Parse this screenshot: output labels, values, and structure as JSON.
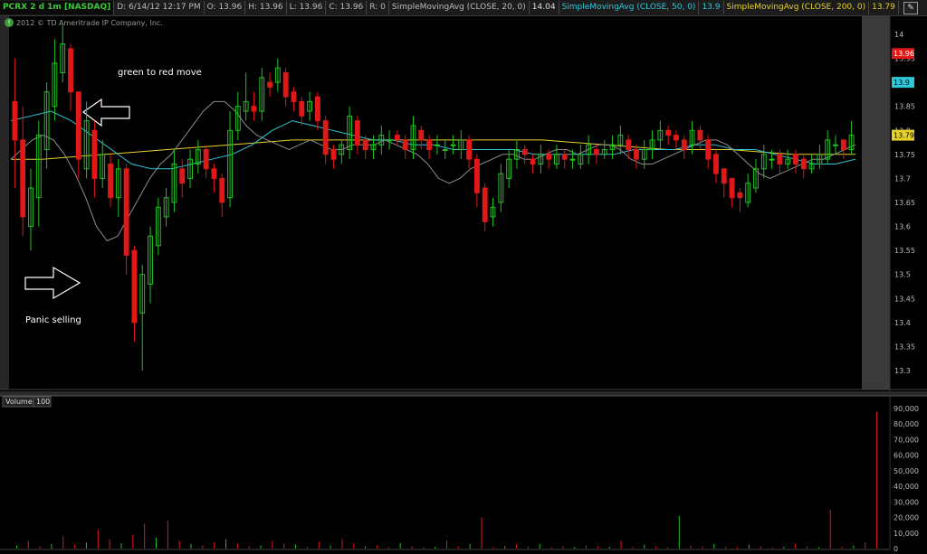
{
  "header": {
    "symbol": "PCRX 2 d 1m [NASDAQ]",
    "date": "D: 6/14/12 12:17 PM",
    "open": "O: 13.96",
    "high": "H: 13.96",
    "low": "L: 13.96",
    "close": "C: 13.96",
    "range": "R: 0",
    "sma20_label": "SimpleMovingAvg (CLOSE, 20, 0)",
    "sma20_value": "14.04",
    "sma50_label": "SimpleMovingAvg (CLOSE, 50, 0)",
    "sma50_value": "13.9",
    "sma200_label": "SimpleMovingAvg (CLOSE, 200, 0)",
    "sma200_value": "13.79",
    "tool_icon": "drawing-tools-icon"
  },
  "copyright": "2012 © TD Ameritrade IP Company, Inc.",
  "annotations": {
    "top": "green to red move",
    "bottom": "Panic selling"
  },
  "volume_panel": {
    "label": "Volume",
    "period": "100"
  },
  "colors": {
    "up": "#22c022",
    "down": "#e01818",
    "sma20": "#8c8c8c",
    "sma50": "#2ec8d8",
    "sma200": "#e6d22a",
    "price_badge": "#e01818",
    "sma50_badge": "#2ec8d8",
    "sma200_badge": "#e6d22a"
  },
  "chart_data": [
    {
      "type": "candlestick",
      "title": "PCRX 2 d 1m [NASDAQ]",
      "ylim": [
        13.27,
        14.03
      ],
      "y_ticks": [
        "14",
        "13.95",
        "13.9",
        "13.85",
        "13.8",
        "13.75",
        "13.7",
        "13.65",
        "13.6",
        "13.55",
        "13.5",
        "13.45",
        "13.4",
        "13.35",
        "13.3"
      ],
      "badges": [
        {
          "name": "price",
          "value": 13.96,
          "text": "13.96"
        },
        {
          "name": "sma50",
          "value": 13.9,
          "text": "13.9"
        },
        {
          "name": "sma200",
          "value": 13.79,
          "text": "13.79"
        }
      ],
      "candles_open": [
        13.86,
        13.78,
        13.6,
        13.66,
        13.76,
        13.85,
        13.92,
        13.97,
        13.88,
        13.72,
        13.8,
        13.7,
        13.73,
        13.66,
        13.72,
        13.55,
        13.42,
        13.48,
        13.56,
        13.62,
        13.65,
        13.72,
        13.7,
        13.73,
        13.76,
        13.72,
        13.7,
        13.66,
        13.8,
        13.84,
        13.85,
        13.84,
        13.9,
        13.9,
        13.92,
        13.88,
        13.86,
        13.84,
        13.87,
        13.82,
        13.76,
        13.75,
        13.76,
        13.82,
        13.78,
        13.76,
        13.77,
        13.78,
        13.79,
        13.78,
        13.76,
        13.8,
        13.78,
        13.77,
        13.76,
        13.77,
        13.76,
        13.78,
        13.74,
        13.68,
        13.62,
        13.65,
        13.7,
        13.74,
        13.76,
        13.74,
        13.73,
        13.75,
        13.73,
        13.75,
        13.74,
        13.73,
        13.75,
        13.76,
        13.75,
        13.76,
        13.77,
        13.78,
        13.76,
        13.74,
        13.76,
        13.78,
        13.8,
        13.79,
        13.78,
        13.77,
        13.8,
        13.78,
        13.75,
        13.72,
        13.7,
        13.67,
        13.65,
        13.68,
        13.72,
        13.74,
        13.75,
        13.73,
        13.75,
        13.74,
        13.72,
        13.73,
        13.74,
        13.77,
        13.78,
        13.76
      ],
      "candles_close": [
        13.78,
        13.62,
        13.68,
        13.79,
        13.88,
        13.94,
        13.98,
        13.88,
        13.74,
        13.82,
        13.7,
        13.75,
        13.66,
        13.72,
        13.54,
        13.4,
        13.5,
        13.58,
        13.64,
        13.66,
        13.73,
        13.69,
        13.74,
        13.76,
        13.72,
        13.7,
        13.65,
        13.8,
        13.85,
        13.86,
        13.84,
        13.91,
        13.89,
        13.93,
        13.87,
        13.86,
        13.83,
        13.86,
        13.82,
        13.75,
        13.74,
        13.77,
        13.83,
        13.77,
        13.76,
        13.77,
        13.79,
        13.78,
        13.78,
        13.76,
        13.81,
        13.78,
        13.76,
        13.77,
        13.76,
        13.77,
        13.78,
        13.74,
        13.67,
        13.61,
        13.64,
        13.71,
        13.74,
        13.76,
        13.75,
        13.73,
        13.75,
        13.74,
        13.75,
        13.74,
        13.74,
        13.75,
        13.77,
        13.75,
        13.76,
        13.77,
        13.79,
        13.76,
        13.74,
        13.76,
        13.78,
        13.8,
        13.79,
        13.78,
        13.76,
        13.8,
        13.78,
        13.74,
        13.71,
        13.69,
        13.66,
        13.66,
        13.69,
        13.72,
        13.75,
        13.74,
        13.73,
        13.74,
        13.73,
        13.72,
        13.73,
        13.75,
        13.78,
        13.77,
        13.76,
        13.79
      ],
      "candles_high": [
        13.95,
        13.85,
        13.72,
        13.82,
        13.9,
        13.99,
        14.02,
        13.98,
        13.88,
        13.86,
        13.82,
        13.78,
        13.75,
        13.74,
        13.73,
        13.56,
        13.52,
        13.6,
        13.66,
        13.68,
        13.76,
        13.74,
        13.76,
        13.78,
        13.77,
        13.73,
        13.71,
        13.84,
        13.88,
        13.92,
        13.88,
        13.93,
        13.92,
        13.95,
        13.93,
        13.89,
        13.87,
        13.88,
        13.88,
        13.83,
        13.77,
        13.78,
        13.85,
        13.83,
        13.79,
        13.79,
        13.81,
        13.8,
        13.8,
        13.79,
        13.83,
        13.81,
        13.79,
        13.79,
        13.78,
        13.79,
        13.8,
        13.79,
        13.75,
        13.69,
        13.66,
        13.73,
        13.76,
        13.78,
        13.77,
        13.75,
        13.77,
        13.76,
        13.77,
        13.76,
        13.76,
        13.77,
        13.79,
        13.77,
        13.78,
        13.79,
        13.81,
        13.79,
        13.77,
        13.78,
        13.8,
        13.82,
        13.81,
        13.8,
        13.79,
        13.82,
        13.81,
        13.79,
        13.76,
        13.72,
        13.7,
        13.68,
        13.71,
        13.74,
        13.77,
        13.76,
        13.76,
        13.76,
        13.76,
        13.75,
        13.75,
        13.77,
        13.8,
        13.79,
        13.78,
        13.82
      ],
      "candles_low": [
        13.68,
        13.58,
        13.55,
        13.6,
        13.72,
        13.82,
        13.9,
        13.84,
        13.7,
        13.7,
        13.66,
        13.68,
        13.64,
        13.62,
        13.5,
        13.36,
        13.3,
        13.44,
        13.54,
        13.6,
        13.63,
        13.66,
        13.68,
        13.71,
        13.7,
        13.67,
        13.62,
        13.64,
        13.78,
        13.82,
        13.82,
        13.82,
        13.87,
        13.88,
        13.85,
        13.84,
        13.81,
        13.82,
        13.8,
        13.73,
        13.72,
        13.73,
        13.74,
        13.75,
        13.74,
        13.74,
        13.75,
        13.76,
        13.77,
        13.74,
        13.74,
        13.76,
        13.74,
        13.75,
        13.74,
        13.75,
        13.74,
        13.72,
        13.64,
        13.59,
        13.6,
        13.63,
        13.68,
        13.72,
        13.73,
        13.71,
        13.71,
        13.72,
        13.72,
        13.72,
        13.72,
        13.72,
        13.73,
        13.73,
        13.74,
        13.74,
        13.75,
        13.74,
        13.72,
        13.72,
        13.74,
        13.76,
        13.77,
        13.76,
        13.74,
        13.75,
        13.76,
        13.72,
        13.69,
        13.66,
        13.64,
        13.63,
        13.64,
        13.67,
        13.7,
        13.72,
        13.71,
        13.72,
        13.71,
        13.7,
        13.71,
        13.72,
        13.73,
        13.75,
        13.74,
        13.75
      ],
      "sma20": [
        13.74,
        13.76,
        13.78,
        13.79,
        13.78,
        13.75,
        13.71,
        13.66,
        13.6,
        13.57,
        13.58,
        13.62,
        13.66,
        13.7,
        13.73,
        13.75,
        13.78,
        13.81,
        13.84,
        13.86,
        13.86,
        13.84,
        13.81,
        13.79,
        13.78,
        13.77,
        13.76,
        13.77,
        13.78,
        13.77,
        13.76,
        13.76,
        13.77,
        13.77,
        13.77,
        13.78,
        13.77,
        13.76,
        13.75,
        13.73,
        13.7,
        13.69,
        13.7,
        13.72,
        13.73,
        13.74,
        13.75,
        13.75,
        13.74,
        13.74,
        13.75,
        13.76,
        13.76,
        13.75,
        13.76,
        13.77,
        13.77,
        13.76,
        13.74,
        13.73,
        13.73,
        13.74,
        13.75,
        13.76,
        13.77,
        13.78,
        13.78,
        13.77,
        13.75,
        13.73,
        13.71,
        13.7,
        13.71,
        13.72,
        13.73,
        13.74,
        13.74,
        13.75,
        13.76,
        13.77
      ],
      "sma50": [
        13.82,
        13.83,
        13.84,
        13.82,
        13.79,
        13.76,
        13.73,
        13.72,
        13.72,
        13.73,
        13.74,
        13.75,
        13.77,
        13.8,
        13.82,
        13.81,
        13.8,
        13.79,
        13.78,
        13.78,
        13.77,
        13.77,
        13.76,
        13.76,
        13.76,
        13.76,
        13.75,
        13.75,
        13.75,
        13.75,
        13.75,
        13.76,
        13.76,
        13.76,
        13.77,
        13.77,
        13.76,
        13.76,
        13.75,
        13.74,
        13.73,
        13.73,
        13.74
      ],
      "sma200": [
        13.74,
        13.74,
        13.745,
        13.75,
        13.755,
        13.76,
        13.765,
        13.77,
        13.775,
        13.78,
        13.78,
        13.78,
        13.78,
        13.78,
        13.78,
        13.78,
        13.78,
        13.78,
        13.775,
        13.77,
        13.765,
        13.76,
        13.76,
        13.76,
        13.755,
        13.75,
        13.75,
        13.75
      ]
    },
    {
      "type": "bar",
      "title": "Volume",
      "ylim": [
        0,
        90000
      ],
      "y_ticks": [
        "90,000",
        "80,000",
        "70,000",
        "60,000",
        "50,000",
        "40,000",
        "30,000",
        "20,000",
        "10,000",
        "0"
      ],
      "values": [
        2000,
        5000,
        1500,
        3000,
        8000,
        2500,
        4000,
        12000,
        6000,
        3500,
        9000,
        16000,
        7000,
        18000,
        5000,
        3000,
        2000,
        4000,
        6000,
        3000,
        1500,
        2000,
        5000,
        3000,
        2500,
        1000,
        4500,
        2000,
        6000,
        3000,
        1500,
        2000,
        1000,
        3500,
        1500,
        800,
        1200,
        5000,
        1500,
        3000,
        20000,
        1000,
        1500,
        2500,
        1200,
        3000,
        800,
        1500,
        1000,
        2000,
        1500,
        1200,
        5000,
        1000,
        2500,
        1500,
        800,
        21000,
        2000,
        1500,
        3000,
        1200,
        1000,
        2500,
        1500,
        800,
        1200,
        3000,
        1500,
        1000,
        25000,
        1200,
        2000,
        4000,
        88000
      ]
    }
  ]
}
